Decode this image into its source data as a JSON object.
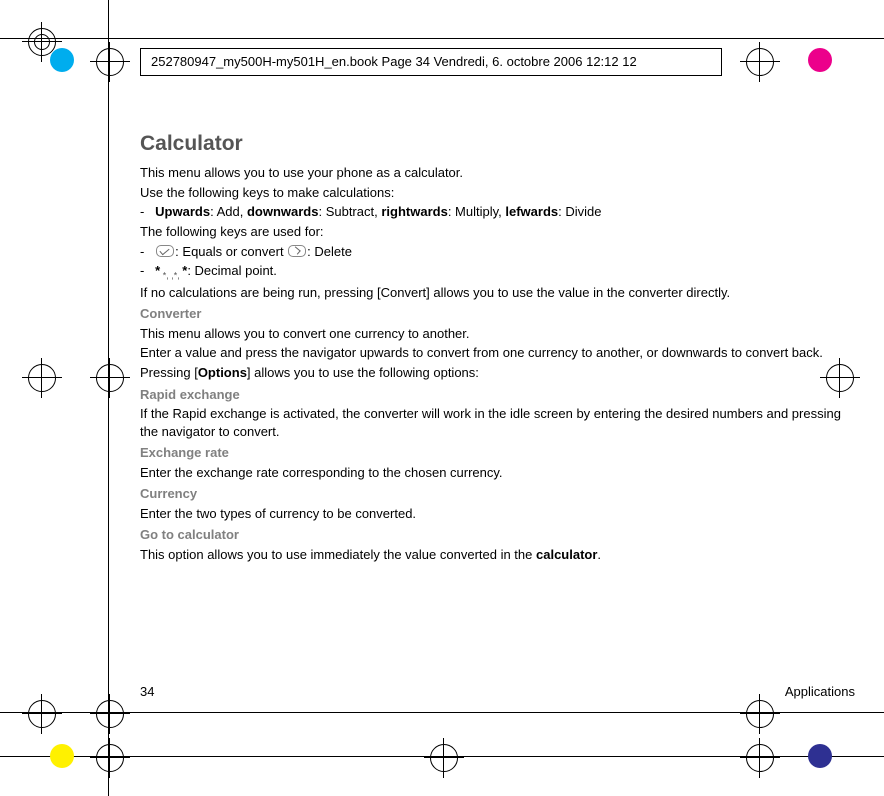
{
  "header": "252780947_my500H-my501H_en.book  Page 34  Vendredi, 6. octobre 2006  12:12 12",
  "title": "Calculator",
  "p1": "This menu allows you to use your phone as a calculator.",
  "p2": "Use the following keys to make calculations:",
  "dirLine": {
    "up": "Upwards",
    "add": ": Add, ",
    "down": "downwards",
    "sub": ": Subtract, ",
    "right": "rightwards",
    "mul": ": Multiply, ",
    "left": "lefwards",
    "div": ": Divide"
  },
  "p3": "The following keys are used for:",
  "keyLine1": {
    "a": ": Equals or convert ",
    "b": ": Delete"
  },
  "keyLine2": ": Decimal point.",
  "p4": "If no calculations are being run, pressing [Convert] allows you to use the value in the converter directly.",
  "h_conv": "Converter",
  "conv1": "This menu allows you to convert one currency to another.",
  "conv2": "Enter a value and press the navigator upwards to convert from one currency to another, or downwards to convert back.",
  "conv3a": "Pressing [",
  "conv3b": "Options",
  "conv3c": "] allows you to use the following options:",
  "h_rapid": "Rapid exchange",
  "rapid1": "If the Rapid exchange is activated, the converter will work in the idle screen by entering the desired numbers and pressing the navigator to convert.",
  "h_rate": "Exchange rate",
  "rate1": "Enter the exchange rate corresponding to the chosen currency.",
  "h_cur": "Currency",
  "cur1": "Enter the two types of currency to be converted.",
  "h_goto": "Go to calculator",
  "goto1a": "This option allows you to use immediately the value converted in the ",
  "goto1b": "calculator",
  "goto1c": ".",
  "footer": {
    "page": "34",
    "section": "Applications"
  },
  "colors": {
    "c1": "#00adee",
    "c2": "#ec008b",
    "c3": "#fff100",
    "c4": "#2e3092"
  }
}
